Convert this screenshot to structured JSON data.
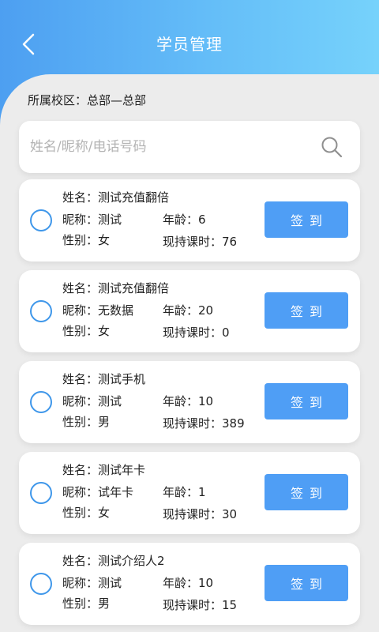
{
  "header": {
    "title": "学员管理"
  },
  "campus": {
    "text": "所属校区：总部—总部"
  },
  "search": {
    "placeholder": "姓名/昵称/电话号码",
    "value": ""
  },
  "colors": {
    "accent": "#4f9ef5",
    "header_start": "#4d9ff1",
    "header_end": "#76d2fb",
    "background": "#ececec"
  },
  "icons": {
    "back": "chevron-left-icon",
    "search": "search-icon"
  },
  "students": [
    {
      "name": "姓名：测试充值翻倍",
      "nickname": "昵称：测试",
      "gender": "性别：女",
      "age": "年龄：6",
      "hours": "现持课时：76",
      "button": "签到"
    },
    {
      "name": "姓名：测试充值翻倍",
      "nickname": "昵称：无数据",
      "gender": "性别：女",
      "age": "年龄：20",
      "hours": "现持课时：0",
      "button": "签到"
    },
    {
      "name": "姓名：测试手机",
      "nickname": "昵称：测试",
      "gender": "性别：男",
      "age": "年龄：10",
      "hours": "现持课时：389",
      "button": "签到"
    },
    {
      "name": "姓名：测试年卡",
      "nickname": "昵称：试年卡",
      "gender": "性别：女",
      "age": "年龄：1",
      "hours": "现持课时：30",
      "button": "签到"
    },
    {
      "name": "姓名：测试介绍人2",
      "nickname": "昵称：测试",
      "gender": "性别：男",
      "age": "年龄：10",
      "hours": "现持课时：15",
      "button": "签到"
    }
  ]
}
